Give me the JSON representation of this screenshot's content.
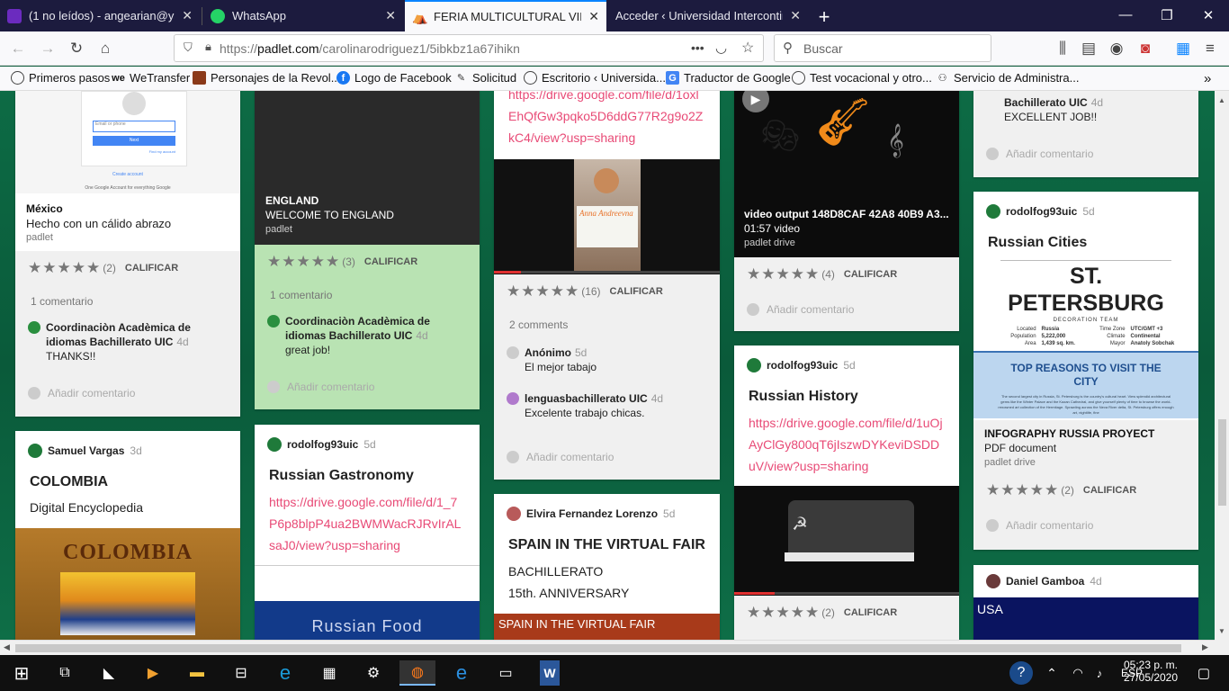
{
  "tabs": [
    {
      "title": "(1 no leídos) - angearian@yahoo",
      "color": "#6b2bbf"
    },
    {
      "title": "WhatsApp",
      "color": "#25d366"
    },
    {
      "title": "FERIA MULTICULTURAL VIRTUAL",
      "color": "#d93b3b"
    },
    {
      "title": "Acceder ‹ Universidad Intercontinental",
      "color": "#888"
    }
  ],
  "url": {
    "prefix": "https://",
    "host": "padlet.com",
    "path": "/carolinarodriguez1/5ibkbz1a67ihikn",
    "dots": "•••"
  },
  "search": {
    "placeholder": "Buscar"
  },
  "bookmarks": [
    {
      "label": "Primeros pasos"
    },
    {
      "label": "WeTransfer"
    },
    {
      "label": "Personajes de la Revol..."
    },
    {
      "label": "Logo de Facebook"
    },
    {
      "label": "Solicitud"
    },
    {
      "label": "Escritorio ‹ Universida..."
    },
    {
      "label": "Traductor de Google"
    },
    {
      "label": "Test vocacional y otro..."
    },
    {
      "label": "Servicio de Administra..."
    }
  ],
  "col1": {
    "card1": {
      "google_box": {
        "placeholder": "Email or phone",
        "next": "Next",
        "find": "Find my account",
        "create": "Create account",
        "footer": "One Google Account for everything Google"
      },
      "att_title": "México",
      "att_sub": "Hecho con un cálido abrazo",
      "att_src": "padlet",
      "stars": "★★★★★",
      "count": "(2)",
      "rate": "CALIFICAR",
      "comments_count": "1 comentario",
      "comments": [
        {
          "author": "Coordinaciòn Acadèmica de idiomas Bachillerato UIC",
          "ago": "4d",
          "text": "THANKS!!"
        }
      ],
      "add_comment": "Añadir comentario"
    },
    "card2": {
      "author": "Samuel Vargas",
      "ago": "3d",
      "title": "COLOMBIA",
      "body": "Digital Encyclopedia",
      "cover": "COLOMBIA"
    }
  },
  "col2": {
    "card1": {
      "att_title": "ENGLAND",
      "att_sub": "WELCOME TO ENGLAND",
      "att_src": "padlet",
      "stars": "★★★★★",
      "count": "(3)",
      "rate": "CALIFICAR",
      "comments_count": "1 comentario",
      "comments": [
        {
          "author": "Coordinaciòn Acadèmica de idiomas Bachillerato UIC",
          "ago": "4d",
          "text": "great job!"
        }
      ],
      "add_comment": "Añadir comentario"
    },
    "card2": {
      "author": "rodolfog93uic",
      "ago": "5d",
      "title": "Russian Gastronomy",
      "link": "https://drive.google.com/file/d/1_7P6p8blpP4ua2BWMWacRJRvIrALsaJ0/view?usp=sharing",
      "cover": "Russian Food"
    }
  },
  "col3": {
    "card1": {
      "link": "https://drive.google.com/file/d/1oxlEhQfGw3pqko5D6ddG77R2g9o2ZkC4/view?usp=sharing",
      "sign": "Anna Andreevna",
      "stars": "★★★★★",
      "count": "(16)",
      "rate": "CALIFICAR",
      "comments_count": "2 comments",
      "comments": [
        {
          "author": "Anónimo",
          "ago": "5d",
          "text": "El mejor tabajo"
        },
        {
          "author": "lenguasbachillerato UIC",
          "ago": "4d",
          "text": "Excelente trabajo chicas."
        }
      ],
      "add_comment": "Añadir comentario"
    },
    "card2": {
      "author": "Elvira Fernandez Lorenzo",
      "ago": "5d",
      "title": "SPAIN IN THE VIRTUAL FAIR",
      "body1": "BACHILLERATO",
      "body2": "15th. ANNIVERSARY",
      "banner": "SPAIN IN THE VIRTUAL FAIR"
    }
  },
  "col4": {
    "card1": {
      "att_title": "video output 148D8CAF 42A8 40B9 A3...",
      "att_sub": "01:57 video",
      "att_src": "padlet drive",
      "stars": "★★★★★",
      "count": "(4)",
      "rate": "CALIFICAR",
      "add_comment": "Añadir comentario"
    },
    "card2": {
      "author": "rodolfog93uic",
      "ago": "5d",
      "title": "Russian History",
      "link": "https://drive.google.com/file/d/1uOjAyClGy800qT6jIszwDYKeviDSDDuV/view?usp=sharing",
      "stars": "★★★★★",
      "count": "(2)",
      "rate": "CALIFICAR"
    }
  },
  "col5": {
    "card1": {
      "comments": [
        {
          "author": "Bachillerato UIC",
          "ago": "4d",
          "text": "EXCELLENT JOB!!"
        }
      ],
      "add_comment": "Añadir comentario"
    },
    "card2": {
      "author": "rodolfog93uic",
      "ago": "5d",
      "title": "Russian Cities",
      "poster_title": "ST. PETERSBURG",
      "poster_team": "DECORATION TEAM",
      "poster_rows": [
        [
          "Located",
          "Russia",
          "Time Zone",
          "UTC/GMT +3"
        ],
        [
          "Population",
          "5,222,000",
          "Climate",
          "Continental"
        ],
        [
          "Area",
          "1,439 sq. km.",
          "Mayor",
          "Anatoly Sobchak"
        ]
      ],
      "poster_reasons": "TOP REASONS TO VISIT THE CITY",
      "poster_blurb": "The second largest city in Russia, St. Petersburg is the country's cultural heart. View splendid architectural gems like the Winter Palace and the Kazan Cathedral, and give yourself plenty of time to browse the world-renowned art collection of the Hermitage. Sprawling across the Neva River delta, St. Petersburg offers enough art, nightlife, fine",
      "att_title": "INFOGRAPHY RUSSIA PROYECT",
      "att_sub": "PDF document",
      "att_src": "padlet drive",
      "stars": "★★★★★",
      "count": "(2)",
      "rate": "CALIFICAR",
      "add_comment": "Añadir comentario"
    },
    "card3": {
      "author": "Daniel Gamboa",
      "ago": "4d",
      "banner": "USA"
    }
  },
  "taskbar": {
    "lang": "ESP",
    "time": "05:23 p. m.",
    "date": "27/05/2020"
  }
}
